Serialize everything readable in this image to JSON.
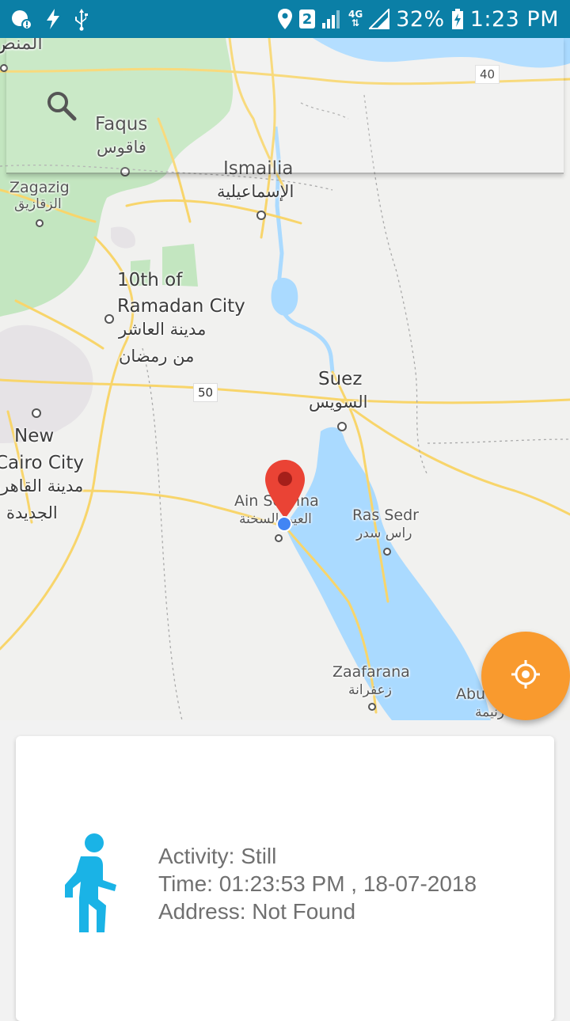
{
  "status_bar": {
    "battery_percent": "32%",
    "time": "1:23 PM",
    "network": "4G",
    "sim_slot": "2",
    "icons": [
      "location-warning-icon",
      "flash-icon",
      "usb-icon",
      "location-pin-icon",
      "sim-2-icon",
      "signal-icon",
      "4g-data-icon",
      "signal-2-icon",
      "battery-charging-icon"
    ]
  },
  "map": {
    "labels": {
      "faqus": "Faqus",
      "faqus_ar": "فاقوس",
      "ismailia": "Ismailia",
      "ismailia_ar": "الإسماعيلية",
      "zagazig": "Zagazig",
      "zagazig_ar": "الزقازيق",
      "ramadan_1": "10th of",
      "ramadan_2": "Ramadan City",
      "ramadan_ar_1": "مدينة العاشر",
      "ramadan_ar_2": "من رمضان",
      "suez": "Suez",
      "suez_ar": "السويس",
      "newcairo_1": "New",
      "newcairo_2": "Cairo City",
      "newcairo_ar_1": "مدينة القاهرة",
      "newcairo_ar_2": "الجديدة",
      "ainsokhna": "Ain Sokhna",
      "ainsokhna_ar": "العين السخنة",
      "rassedr": "Ras Sedr",
      "rassedr_ar": "راس سدر",
      "zaafarana": "Zaafarana",
      "zaafarana_ar": "زعفرانة",
      "abu": "Abu",
      "abu_ar": "زنيمة",
      "top_left_ar": "المنص"
    },
    "road_shields": {
      "r40": "40",
      "r50": "50"
    },
    "colors": {
      "water": "#aadaff",
      "park": "#c3e6c0",
      "road": "#f8d56b",
      "marker": "#ea4335",
      "dot": "#4285f4"
    }
  },
  "fab": {
    "icon": "my-location-icon",
    "color": "#f99a2e"
  },
  "activity": {
    "activity_line": "Activity: Still",
    "time_line": "Time: 01:23:53 PM , 18-07-2018",
    "address_line": "Address: Not Found",
    "icon": "walking-person-icon",
    "icon_color": "#1ab3e6"
  }
}
